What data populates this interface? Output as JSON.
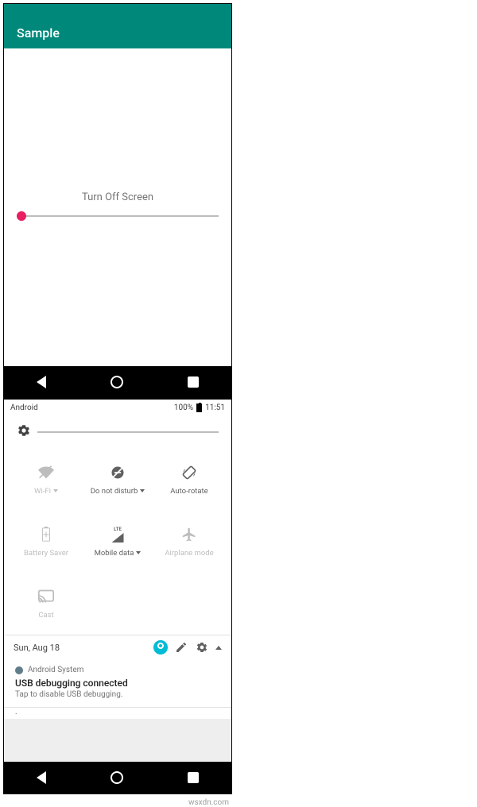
{
  "left": {
    "appbar_title": "Sample",
    "button_label": "Turn Off Screen"
  },
  "right": {
    "status": {
      "carrier": "Android",
      "battery_pct": "100%",
      "time": "11:51"
    },
    "qs": {
      "wifi": "Wi-Fi",
      "dnd": "Do not disturb",
      "autorotate": "Auto-rotate",
      "battery_saver": "Battery Saver",
      "mobile_data": "Mobile data",
      "mobile_badge": "LTE",
      "airplane": "Airplane mode",
      "cast": "Cast"
    },
    "footer_date": "Sun, Aug 18",
    "notification": {
      "app": "Android System",
      "title": "USB debugging connected",
      "text": "Tap to disable USB debugging.",
      "minimized": "."
    }
  },
  "watermark": "wsxdn.com"
}
